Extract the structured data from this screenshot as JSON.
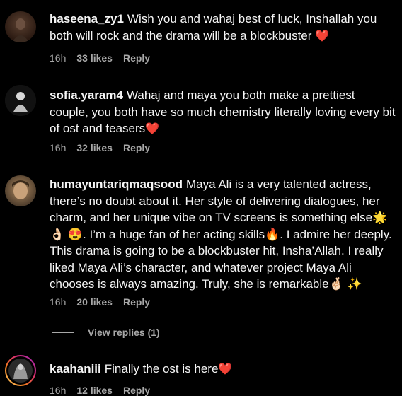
{
  "comments": [
    {
      "username": "haseena_zy1",
      "text": "Wish you and wahaj best of luck, Inshallah you both will rock and the drama will be a blockbuster",
      "emoji": "❤️",
      "time": "16h",
      "likes": "33 likes",
      "reply": "Reply"
    },
    {
      "username": "sofia.yaram4",
      "text": "Wahaj and maya you both make a prettiest couple, you both have so much chemistry literally loving every bit of ost and teasers",
      "emoji": "❤️",
      "time": "16h",
      "likes": "32 likes",
      "reply": "Reply"
    },
    {
      "username": "humayuntariqmaqsood",
      "text": "Maya Ali is a very talented actress, there’s no doubt about it. Her style of delivering dialogues, her charm, and her unique vibe on TV screens is something else🌟 👌🏻 😍. I’m a huge fan of her acting skills🔥. I admire her deeply. This drama is going to be a blockbuster hit, Insha’Allah. I really liked Maya Ali’s character, and whatever project Maya Ali chooses is always amazing. Truly, she is remarkable🤞🏻 ✨",
      "time": "16h",
      "likes": "20 likes",
      "reply": "Reply"
    },
    {
      "username": "kaahaniii",
      "text": "Finally the ost is here",
      "emoji": "❤️",
      "time": "16h",
      "likes": "12 likes",
      "reply": "Reply"
    }
  ],
  "view_replies": "View replies (1)"
}
